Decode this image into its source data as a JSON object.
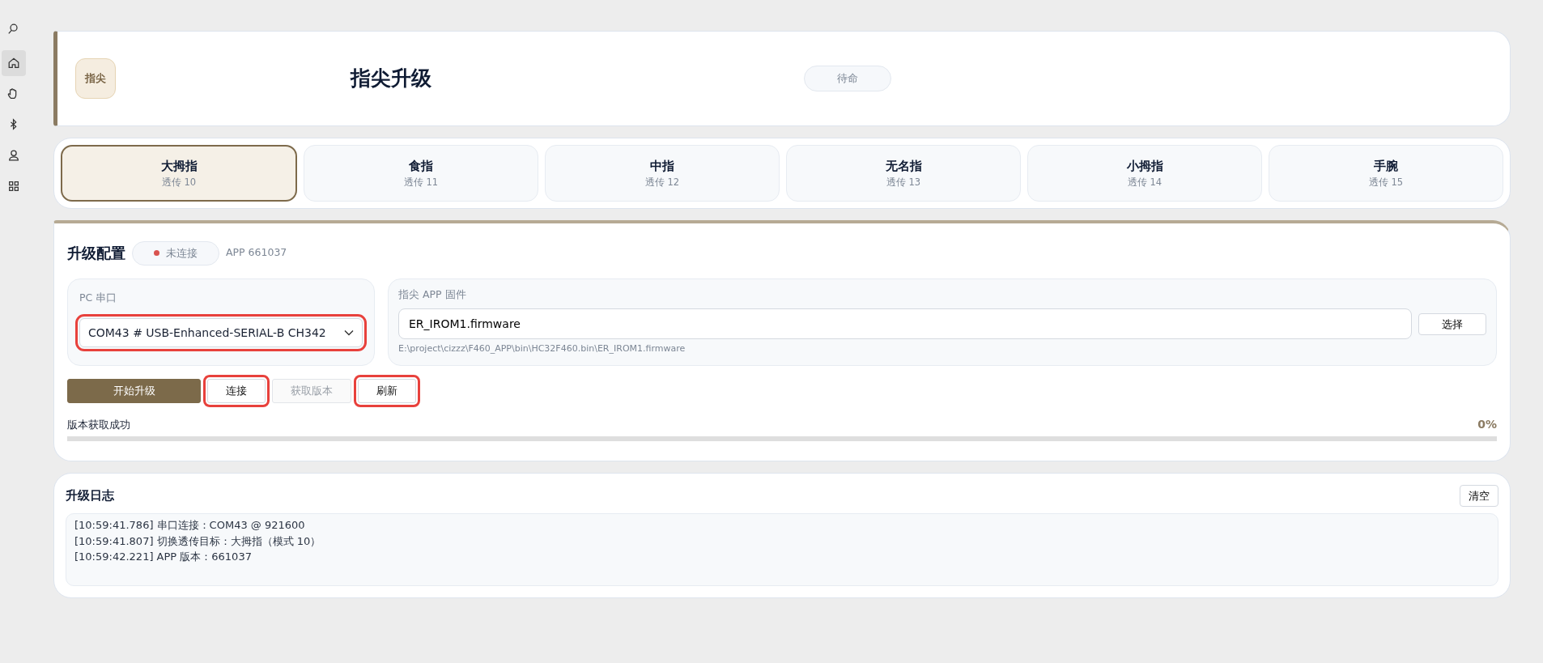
{
  "sidebar": {
    "items": [
      {
        "kind": "search",
        "selected": false
      },
      {
        "kind": "home",
        "selected": true
      },
      {
        "kind": "hand",
        "selected": false
      },
      {
        "kind": "bluetooth",
        "selected": false
      },
      {
        "kind": "user",
        "selected": false
      },
      {
        "kind": "grid",
        "selected": false
      }
    ]
  },
  "header": {
    "badge": "指尖",
    "title": "指尖升级",
    "status": "待命"
  },
  "targets": [
    {
      "name": "大拇指",
      "sub": "透传 10",
      "selected": true
    },
    {
      "name": "食指",
      "sub": "透传 11",
      "selected": false
    },
    {
      "name": "中指",
      "sub": "透传 12",
      "selected": false
    },
    {
      "name": "无名指",
      "sub": "透传 13",
      "selected": false
    },
    {
      "name": "小拇指",
      "sub": "透传 14",
      "selected": false
    },
    {
      "name": "手腕",
      "sub": "透传 15",
      "selected": false
    }
  ],
  "config": {
    "title": "升级配置",
    "connection": {
      "label": "未连接",
      "color": "#d9534f"
    },
    "app_version": "APP 661037",
    "port": {
      "label": "PC 串口",
      "value": "COM43 # USB-Enhanced-SERIAL-B CH342",
      "highlighted": true
    },
    "firmware": {
      "label": "指尖 APP 固件",
      "value": "ER_IROM1.firmware",
      "button": "选择",
      "path": "E:\\project\\cizzz\\F460_APP\\bin\\HC32F460.bin\\ER_IROM1.firmware"
    },
    "buttons": [
      {
        "label": "开始升级",
        "kind": "primary",
        "disabled": false,
        "highlighted": false
      },
      {
        "label": "连接",
        "kind": "plain",
        "disabled": false,
        "highlighted": true
      },
      {
        "label": "获取版本",
        "kind": "plain",
        "disabled": true,
        "highlighted": false
      },
      {
        "label": "刷新",
        "kind": "plain",
        "disabled": false,
        "highlighted": true
      }
    ],
    "message": "版本获取成功",
    "percent": "0%",
    "level": 0
  },
  "log": {
    "title": "升级日志",
    "clear_button": "清空",
    "lines": [
      "[10:59:41.786] 串口连接：COM43 @ 921600",
      "[10:59:41.807] 切换透传目标：大拇指（模式 10）",
      "[10:59:42.221] APP 版本：661037"
    ]
  }
}
